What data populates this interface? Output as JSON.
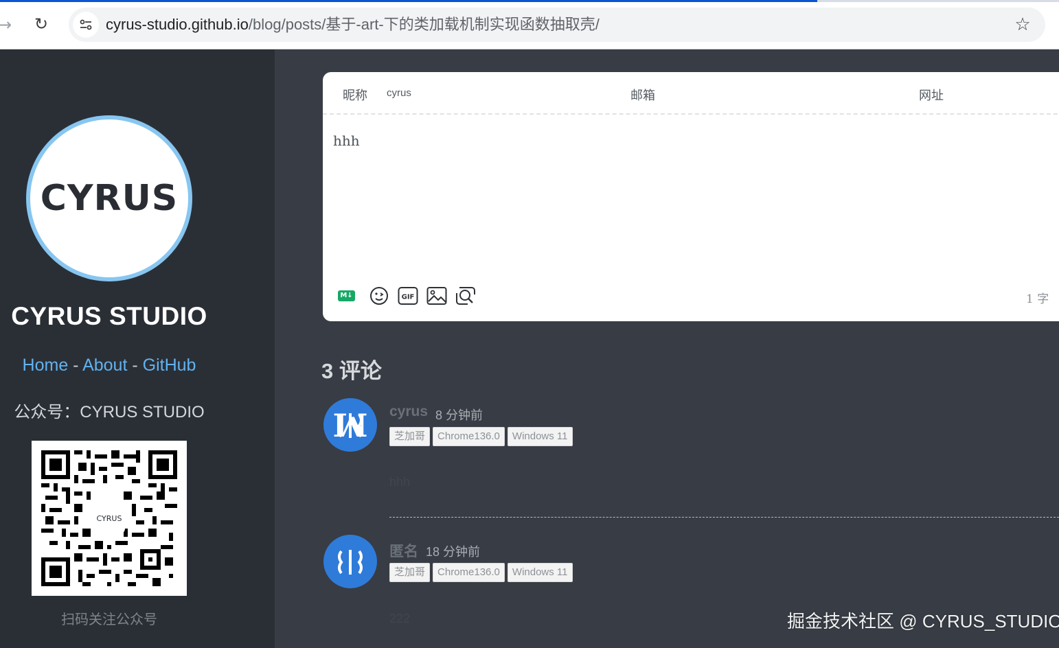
{
  "browser": {
    "url_host": "cyrus-studio.github.io",
    "url_path": "/blog/posts/基于-art-下的类加载机制实现函数抽取壳/"
  },
  "sidebar": {
    "avatar_text": "CYRUS",
    "title": "CYRUS STUDIO",
    "nav": {
      "home": "Home",
      "sep1": " - ",
      "about": "About",
      "sep2": " - ",
      "github": "GitHub"
    },
    "wechat": "公众号：CYRUS STUDIO",
    "qr_logo": "CYRUS",
    "qr_caption": "扫码关注公众号"
  },
  "form": {
    "nick_label": "昵称",
    "nick_value": "cyrus",
    "email_label": "邮箱",
    "url_label": "网址",
    "content": "hhh",
    "md_badge": "M↓",
    "word_count": "1 字"
  },
  "comments_title": "3 评论",
  "comments": [
    {
      "nick": "cyrus",
      "time": "8 分钟前",
      "tags": [
        "芝加哥",
        "Chrome136.0",
        "Windows 11"
      ],
      "content": "hhh"
    },
    {
      "nick": "匿名",
      "time": "18 分钟前",
      "tags": [
        "芝加哥",
        "Chrome136.0",
        "Windows 11"
      ],
      "content": "222"
    }
  ],
  "watermark": "掘金技术社区 @ CYRUS_STUDIO",
  "colors": {
    "sidebar_bg": "#2a2f36",
    "main_bg": "#383c44",
    "link": "#61b2ef",
    "avatar_ring": "#87c6f0",
    "comment_avatar": "#2f7bd9"
  }
}
